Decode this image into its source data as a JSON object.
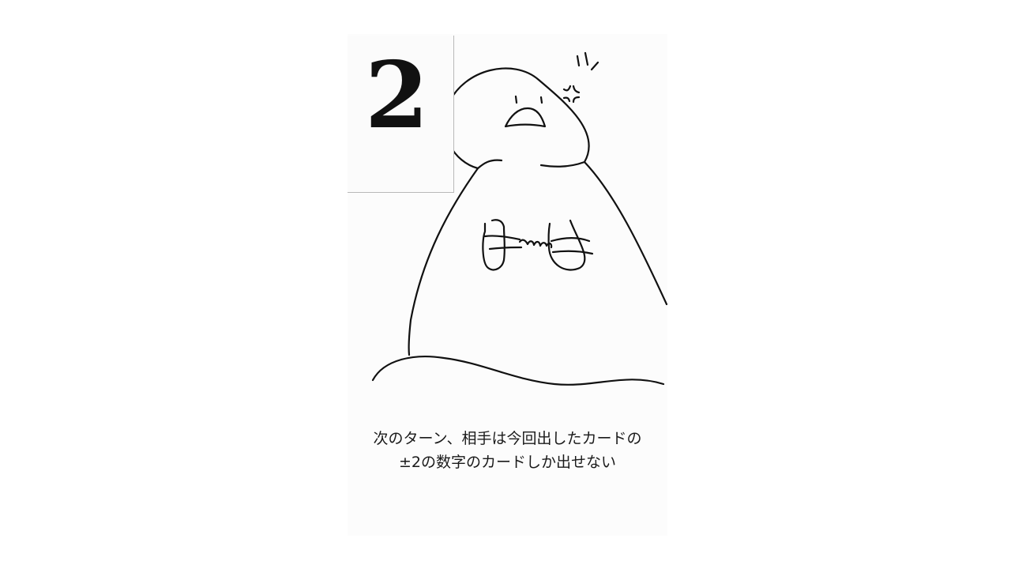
{
  "card": {
    "number": "2",
    "description_lines": [
      "次のターン、相手は今回出したカードの",
      "±2の数字のカードしか出せない"
    ]
  }
}
